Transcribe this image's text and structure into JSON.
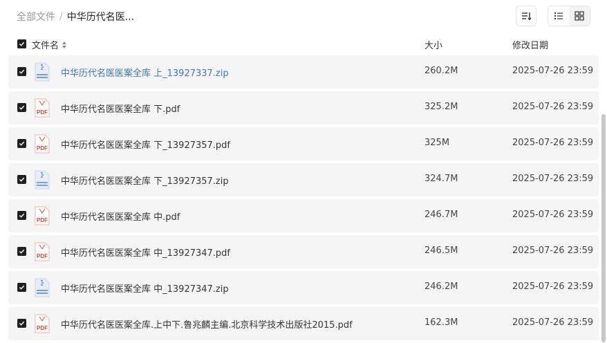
{
  "breadcrumb": {
    "root": "全部文件",
    "separator": "/",
    "current": "中华历代名医..."
  },
  "columns": {
    "name": "文件名",
    "size": "大小",
    "modified": "修改日期"
  },
  "files": [
    {
      "name": "中华历代名医医案全库 上_13927337.zip",
      "type": "zip",
      "size": "260.2M",
      "modified": "2025-07-26 23:59",
      "highlighted": true
    },
    {
      "name": "中华历代名医医案全库 下.pdf",
      "type": "pdf",
      "size": "325.2M",
      "modified": "2025-07-26 23:59"
    },
    {
      "name": "中华历代名医医案全库 下_13927357.pdf",
      "type": "pdf",
      "size": "325M",
      "modified": "2025-07-26 23:59"
    },
    {
      "name": "中华历代名医医案全库 下_13927357.zip",
      "type": "zip",
      "size": "324.7M",
      "modified": "2025-07-26 23:59"
    },
    {
      "name": "中华历代名医医案全库 中.pdf",
      "type": "pdf",
      "size": "246.7M",
      "modified": "2025-07-26 23:59"
    },
    {
      "name": "中华历代名医医案全库 中_13927347.pdf",
      "type": "pdf",
      "size": "246.5M",
      "modified": "2025-07-26 23:59"
    },
    {
      "name": "中华历代名医医案全库 中_13927347.zip",
      "type": "zip",
      "size": "246.2M",
      "modified": "2025-07-26 23:59"
    },
    {
      "name": "中华历代名医医案全库.上中下.鲁兆麟主编.北京科学技术出版社2015.pdf",
      "type": "pdf",
      "size": "162.3M",
      "modified": "2025-07-26 23:59"
    }
  ],
  "icons": {
    "pdf_label": "PDF",
    "pdf_color": "#e04a3a",
    "zip_color": "#7b9fd4"
  },
  "colors": {
    "link": "#3a78c3",
    "row_bg": "#f5f5f5",
    "checkbox": "#1f1f1f"
  }
}
